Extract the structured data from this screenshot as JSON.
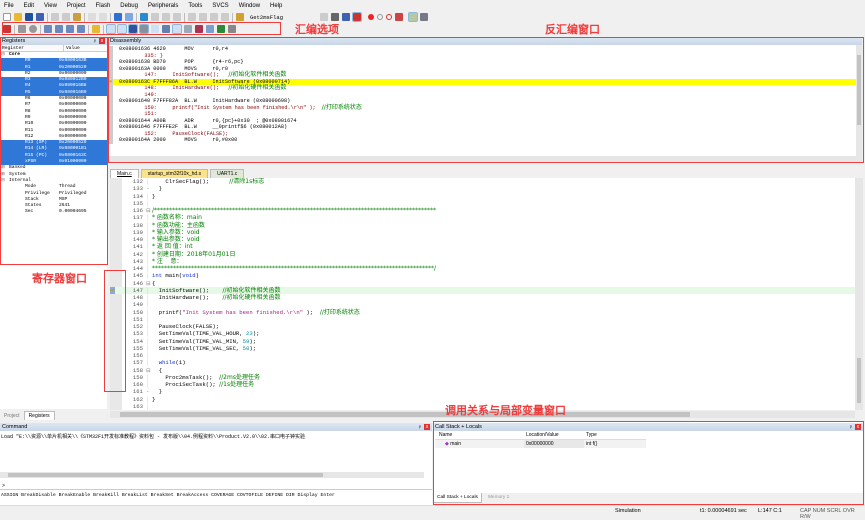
{
  "menu": [
    "File",
    "Edit",
    "View",
    "Project",
    "Flash",
    "Debug",
    "Peripherals",
    "Tools",
    "SVCS",
    "Window",
    "Help"
  ],
  "toolbar": {
    "target_name": "Get2msFlag"
  },
  "annotations": {
    "asm_options": "汇编选项",
    "disassembly_window": "反汇编窗口",
    "register_window": "寄存器窗口",
    "callstack_window": "调用关系与局部变量窗口"
  },
  "colors": {
    "annotation": "#f03c3c",
    "selection": "#3078d8",
    "current_line": "#ffff00"
  },
  "registers": {
    "title": "Registers",
    "columns": [
      "Register",
      "Value"
    ],
    "rows": [
      {
        "name": "Core",
        "value": "",
        "level": 0,
        "sel": false,
        "bold": true
      },
      {
        "name": "R0",
        "value": "0x0800163B",
        "level": 2,
        "sel": true
      },
      {
        "name": "R1",
        "value": "0x20000520",
        "level": 2,
        "sel": true
      },
      {
        "name": "R2",
        "value": "0x00000000",
        "level": 2,
        "sel": false
      },
      {
        "name": "R3",
        "value": "0x080012B0",
        "level": 2,
        "sel": true
      },
      {
        "name": "R4",
        "value": "0x080016B8",
        "level": 2,
        "sel": true
      },
      {
        "name": "R5",
        "value": "0x080016B0",
        "level": 2,
        "sel": true
      },
      {
        "name": "R6",
        "value": "0x00000000",
        "level": 2,
        "sel": false
      },
      {
        "name": "R7",
        "value": "0x00000000",
        "level": 2,
        "sel": false
      },
      {
        "name": "R8",
        "value": "0x00000000",
        "level": 2,
        "sel": false
      },
      {
        "name": "R9",
        "value": "0x00000000",
        "level": 2,
        "sel": false
      },
      {
        "name": "R10",
        "value": "0x00000000",
        "level": 2,
        "sel": false
      },
      {
        "name": "R11",
        "value": "0x00000000",
        "level": 2,
        "sel": false
      },
      {
        "name": "R12",
        "value": "0x00000000",
        "level": 2,
        "sel": false
      },
      {
        "name": "R13 (SP)",
        "value": "0x20000520",
        "level": 2,
        "sel": true
      },
      {
        "name": "R14 (LR)",
        "value": "0x080001B1",
        "level": 2,
        "sel": true
      },
      {
        "name": "R15 (PC)",
        "value": "0x0800163C",
        "level": 2,
        "sel": true
      },
      {
        "name": "xPSR",
        "value": "0x01000000",
        "level": 2,
        "sel": true
      },
      {
        "name": "Banked",
        "value": "",
        "level": 0,
        "sel": false
      },
      {
        "name": "System",
        "value": "",
        "level": 0,
        "sel": false
      },
      {
        "name": "Internal",
        "value": "",
        "level": 0,
        "sel": false
      },
      {
        "name": "Mode",
        "value": "Thread",
        "level": 2,
        "sel": false
      },
      {
        "name": "Privilege",
        "value": "Privileged",
        "level": 2,
        "sel": false
      },
      {
        "name": "Stack",
        "value": "MSP",
        "level": 2,
        "sel": false
      },
      {
        "name": "States",
        "value": "2641",
        "level": 2,
        "sel": false
      },
      {
        "name": "Sec",
        "value": "0.00004695",
        "level": 2,
        "sel": false
      }
    ],
    "bottom_tabs": [
      "Project",
      "Registers"
    ]
  },
  "disassembly": {
    "title": "Disassembly",
    "rows": [
      {
        "type": "asm",
        "text": "0x08001636 4620      MOV      r0,r4"
      },
      {
        "type": "src",
        "text": "   335: }"
      },
      {
        "type": "asm",
        "text": "0x08001638 BD70      POP      {r4-r6,pc}"
      },
      {
        "type": "asm",
        "text": "0x0800163A 0000      MOVS     r0,r0"
      },
      {
        "type": "src",
        "text": "   147:     InitSoftware();   ",
        "comment": "//初始化软件相关函数"
      },
      {
        "type": "asm",
        "text": "0x0800163C F7FFF86A  BL.W     InitSoftware (0x08000714)",
        "current": true
      },
      {
        "type": "src",
        "text": "   148:     InitHardware();   ",
        "comment": "//初始化硬件相关函数"
      },
      {
        "type": "src",
        "text": "   149: "
      },
      {
        "type": "asm",
        "text": "0x08001640 F7FFF82A  BL.W     InitHardware (0x08000698)"
      },
      {
        "type": "src",
        "text": "   150:     printf(\"Init System has been finished.\\r\\n\" );  ",
        "comment": "//打印系统状态"
      },
      {
        "type": "src",
        "text": "   151: "
      },
      {
        "type": "asm",
        "text": "0x08001644 A00B      ADR      r0,{pc}+0x30  ; @0x08001674"
      },
      {
        "type": "asm",
        "text": "0x08001646 F7FFFE2F  BL.W     __0printf$6 (0x080012A8)"
      },
      {
        "type": "src",
        "text": "   152:     PauseClock(FALSE);"
      },
      {
        "type": "asm",
        "text": "0x0800164A 2000      MOVS     r0,#0x00"
      }
    ]
  },
  "editor": {
    "tabs": [
      "Main.c",
      "startup_stm32f10x_hd.s",
      "UART1.c"
    ],
    "active_tab": 0,
    "current_line": 147,
    "lines": [
      {
        "n": 132,
        "segs": [
          [
            "    ClrSecFlag();      ",
            ""
          ],
          [
            "//清除1s标志",
            "cmt"
          ]
        ]
      },
      {
        "n": 133,
        "fold": "-",
        "segs": [
          [
            "  }",
            ""
          ]
        ]
      },
      {
        "n": 134,
        "segs": [
          [
            "}",
            ""
          ]
        ]
      },
      {
        "n": 135,
        "segs": [
          [
            "",
            ""
          ]
        ]
      },
      {
        "n": 136,
        "fold": "⊟",
        "segs": [
          [
            "/**********************************************************************************************",
            "cmt"
          ]
        ]
      },
      {
        "n": 137,
        "segs": [
          [
            "* 函数名称：main",
            "cmt"
          ]
        ]
      },
      {
        "n": 138,
        "segs": [
          [
            "* 函数功能：主函数",
            "cmt"
          ]
        ]
      },
      {
        "n": 139,
        "segs": [
          [
            "* 输入参数：void",
            "cmt"
          ]
        ]
      },
      {
        "n": 140,
        "segs": [
          [
            "* 输出参数：void",
            "cmt"
          ]
        ]
      },
      {
        "n": 141,
        "segs": [
          [
            "* 返 回 值：int",
            "cmt"
          ]
        ]
      },
      {
        "n": 142,
        "segs": [
          [
            "* 创建日期：2018年01月01日",
            "cmt"
          ]
        ]
      },
      {
        "n": 143,
        "segs": [
          [
            "* 注    意：",
            "cmt"
          ]
        ]
      },
      {
        "n": 144,
        "segs": [
          [
            "**********************************************************************************************/",
            "cmt"
          ]
        ]
      },
      {
        "n": 145,
        "segs": [
          [
            "int",
            "kw"
          ],
          [
            " main(",
            ""
          ],
          [
            "void",
            "kw"
          ],
          [
            ")",
            ""
          ]
        ]
      },
      {
        "n": 146,
        "fold": "⊟",
        "segs": [
          [
            "{",
            ""
          ]
        ]
      },
      {
        "n": 147,
        "segs": [
          [
            "  InitSoftware();    ",
            ""
          ],
          [
            "//初始化软件相关函数",
            "cmt"
          ]
        ]
      },
      {
        "n": 148,
        "segs": [
          [
            "  InitHardware();    ",
            ""
          ],
          [
            "//初始化硬件相关函数",
            "cmt"
          ]
        ]
      },
      {
        "n": 149,
        "segs": [
          [
            "",
            ""
          ]
        ]
      },
      {
        "n": 150,
        "segs": [
          [
            "  printf(",
            ""
          ],
          [
            "\"Init System has been finished.\\r\\n\"",
            "str"
          ],
          [
            " );  ",
            ""
          ],
          [
            "//打印系统状态",
            "cmt"
          ]
        ]
      },
      {
        "n": 151,
        "segs": [
          [
            "",
            ""
          ]
        ]
      },
      {
        "n": 152,
        "segs": [
          [
            "  PauseClock(FALSE);",
            ""
          ]
        ]
      },
      {
        "n": 153,
        "segs": [
          [
            "  SetTimeVal(TIME_VAL_HOUR, ",
            ""
          ],
          [
            "23",
            "num"
          ],
          [
            ");",
            ""
          ]
        ]
      },
      {
        "n": 154,
        "segs": [
          [
            "  SetTimeVal(TIME_VAL_MIN, ",
            ""
          ],
          [
            "59",
            "num"
          ],
          [
            ");",
            ""
          ]
        ]
      },
      {
        "n": 155,
        "segs": [
          [
            "  SetTimeVal(TIME_VAL_SEC, ",
            ""
          ],
          [
            "50",
            "num"
          ],
          [
            ");",
            ""
          ]
        ]
      },
      {
        "n": 156,
        "segs": [
          [
            "",
            ""
          ]
        ]
      },
      {
        "n": 157,
        "segs": [
          [
            "  ",
            ""
          ],
          [
            "while",
            "kw"
          ],
          [
            "(1)",
            ""
          ]
        ]
      },
      {
        "n": 158,
        "fold": "⊟",
        "segs": [
          [
            "  {",
            ""
          ]
        ]
      },
      {
        "n": 159,
        "segs": [
          [
            "    Proc2msTask();  ",
            ""
          ],
          [
            "//2ms处理任务",
            "cmt"
          ]
        ]
      },
      {
        "n": 160,
        "segs": [
          [
            "    Proc1SecTask(); ",
            ""
          ],
          [
            "//1s处理任务",
            "cmt"
          ]
        ]
      },
      {
        "n": 161,
        "fold": "-",
        "segs": [
          [
            "  }",
            ""
          ]
        ]
      },
      {
        "n": 162,
        "segs": [
          [
            "}",
            ""
          ]
        ]
      },
      {
        "n": 163,
        "segs": [
          [
            "",
            ""
          ]
        ]
      }
    ]
  },
  "command": {
    "title": "Command",
    "output": "Load \"E:\\\\资源\\\\单片机相关\\\\《STM32F1开发标准教程》资料包 - 发布版\\\\04.例程资料\\\\Product.V2.0\\\\02.串口电子钟实验",
    "prompt": ">",
    "help": "ASSIGN BreakDisable BreakEnable BreakKill BreakList BreakSet BreakAccess COVERAGE COVTOFILE DEFINE DIR Display Enter"
  },
  "callstack": {
    "title": "Call Stack + Locals",
    "columns": [
      "Name",
      "Location/Value",
      "Type"
    ],
    "rows": [
      {
        "name": "main",
        "value": "0x00000000",
        "type": "int f()"
      }
    ],
    "bottom_tabs": [
      "Call Stack + Locals",
      "Memory 1"
    ]
  },
  "status": {
    "mode": "Simulation",
    "time": "t1: 0.00004691 sec",
    "position": "L:147 C:1",
    "indicators": "CAP  NUM  SCRL  OVR  R/W"
  }
}
